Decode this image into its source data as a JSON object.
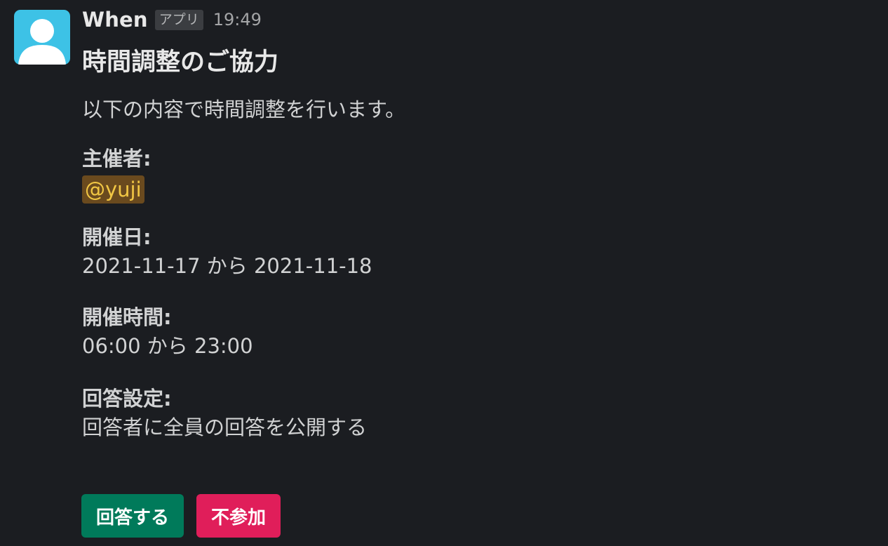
{
  "message": {
    "sender": "When",
    "badge": "アプリ",
    "time": "19:49",
    "avatar_icon": "default-user-avatar",
    "avatar_color": "#3dc2e6"
  },
  "body": {
    "title": "時間調整のご協力",
    "intro": "以下の内容で時間調整を行います。",
    "organizer_label": "主催者:",
    "organizer_mention": "@yuji",
    "date_label": "開催日:",
    "date_value": "2021-11-17 から 2021-11-18",
    "time_label": "開催時間:",
    "time_value": "06:00 から 23:00",
    "answer_label": "回答設定:",
    "answer_value": "回答者に全員の回答を公開する"
  },
  "actions": {
    "answer_button": "回答する",
    "decline_button": "不参加",
    "answer_color": "#007a5a",
    "decline_color": "#e01e5a"
  }
}
